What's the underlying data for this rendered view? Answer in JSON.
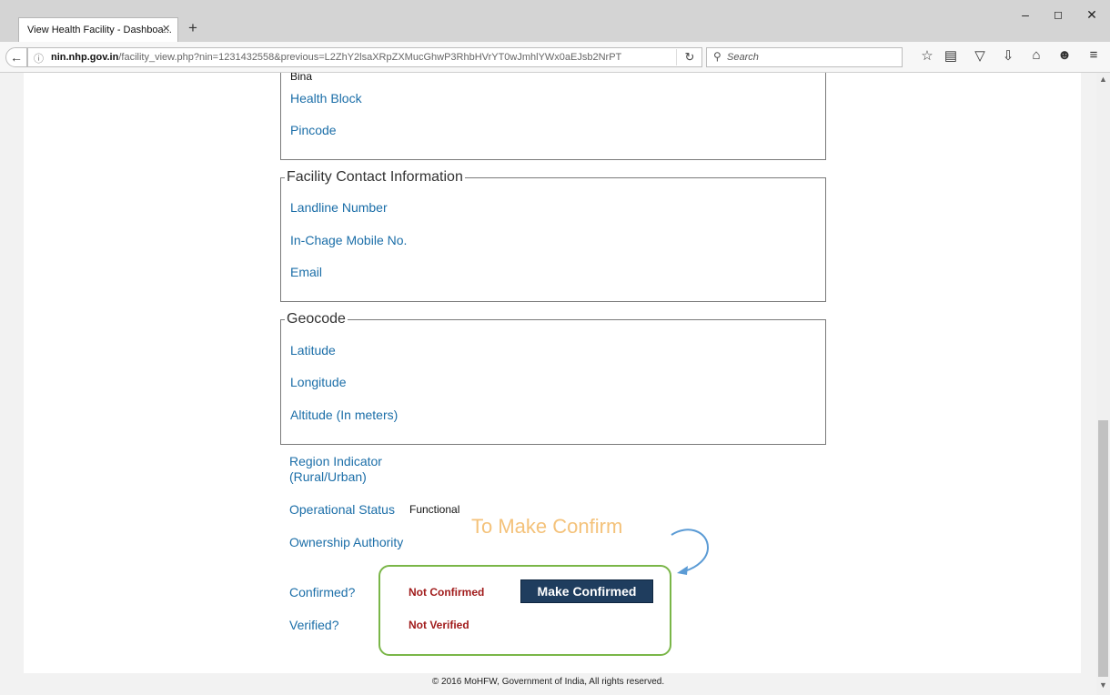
{
  "browser": {
    "tab_title": "View Health Facility - Dashboa...",
    "tab_close": "×",
    "new_tab": "+",
    "url_domain": "nin.nhp.gov.in",
    "url_path": "/facility_view.php?nin=1231432558&previous=L2ZhY2lsaXRpZXMucGhwP3RhbHVrYT0wJmhlYWx0aEJsb2NrPT",
    "search_placeholder": "Search",
    "window_controls": [
      "minimize",
      "maximize",
      "close"
    ]
  },
  "page": {
    "cut_top_value": "Bina",
    "address_fields": [
      "Health Block",
      "Pincode"
    ],
    "contact_section": {
      "legend": "Facility Contact Information",
      "fields": [
        "Landline Number",
        "In-Chage Mobile No.",
        "Email"
      ]
    },
    "geocode_section": {
      "legend": "Geocode",
      "fields": [
        "Latitude",
        "Longitude",
        "Altitude (In meters)"
      ]
    },
    "region_indicator": {
      "line1": "Region Indicator",
      "line2": "(Rural/Urban)"
    },
    "operational_status": {
      "label": "Operational Status",
      "value": "Functional"
    },
    "ownership_authority": {
      "label": "Ownership Authority"
    },
    "confirmed": {
      "label": "Confirmed?",
      "value": "Not Confirmed"
    },
    "verified": {
      "label": "Verified?",
      "value": "Not Verified"
    },
    "make_confirmed_button": "Make Confirmed",
    "annotation": "To Make Confirm",
    "footer": "© 2016 MoHFW, Government of India, All rights reserved."
  },
  "colors": {
    "field_label": "#1b6ea8",
    "status_red": "#a11c1c",
    "button_bg": "#1f3d5e",
    "highlight_green": "#7ab648",
    "annotation": "#f4c27a",
    "arrow": "#5b9bd5"
  },
  "icons": {
    "back": "back-arrow-icon",
    "info": "info-icon",
    "reload": "reload-icon",
    "search": "search-icon",
    "bookmark": "star-icon",
    "reading_list": "reading-list-icon",
    "pocket": "pocket-icon",
    "downloads": "download-icon",
    "home": "home-icon",
    "sync": "sync-icon",
    "menu": "hamburger-menu-icon"
  }
}
